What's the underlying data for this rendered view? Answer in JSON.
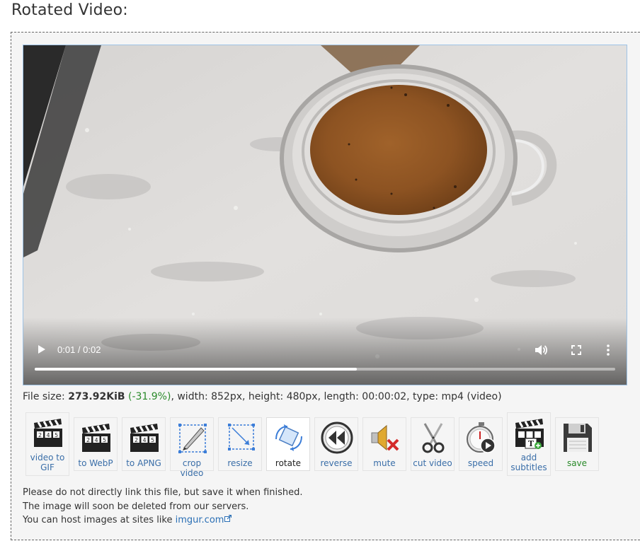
{
  "page": {
    "title": "Rotated Video:"
  },
  "video": {
    "time_display": "0:01 / 0:02",
    "progress": 0.555
  },
  "file_info": {
    "size_label": "File size: ",
    "size_value": "273.92KiB",
    "change": "(-31.9%)",
    "details": ", width: 852px, height: 480px, length: 00:00:02, type: mp4 (video)"
  },
  "tools": [
    {
      "label": "video to GIF",
      "icon": "clapperboard-icon"
    },
    {
      "label": "to WebP",
      "icon": "clapperboard-icon"
    },
    {
      "label": "to APNG",
      "icon": "clapperboard-icon"
    },
    {
      "label": "crop video",
      "icon": "crop-icon"
    },
    {
      "label": "resize",
      "icon": "resize-icon"
    },
    {
      "label": "rotate",
      "icon": "rotate-icon"
    },
    {
      "label": "reverse",
      "icon": "reverse-icon"
    },
    {
      "label": "mute",
      "icon": "mute-icon"
    },
    {
      "label": "cut video",
      "icon": "scissors-icon"
    },
    {
      "label": "speed",
      "icon": "stopwatch-icon"
    },
    {
      "label": "add subtitles",
      "icon": "subtitles-icon"
    },
    {
      "label": "save",
      "icon": "floppy-disk-icon"
    }
  ],
  "notice": {
    "line1": "Please do not directly link this file, but save it when finished.",
    "line2": "The image will soon be deleted from our servers.",
    "line3_prefix": "You can host images at sites like ",
    "link_text": "imgur.com"
  },
  "colors": {
    "link": "#3a6ea8",
    "positive": "#2a8a2a",
    "border": "#666666"
  }
}
